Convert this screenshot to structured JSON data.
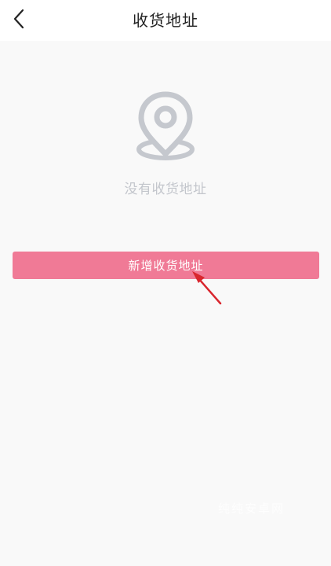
{
  "header": {
    "title": "收货地址",
    "back_icon": "chevron-left-icon"
  },
  "empty_state": {
    "icon": "location-pin-icon",
    "message": "没有收货地址"
  },
  "actions": {
    "add_address_label": "新增收货地址"
  },
  "annotation": {
    "icon": "red-arrow-icon",
    "color": "#d9262e"
  },
  "watermark": {
    "text": "纯纯安卓网"
  },
  "colors": {
    "primary_button": "#f07a96",
    "empty_icon": "#c5c8ce",
    "empty_text": "#c3c6cc",
    "background": "#f9f9f9"
  }
}
